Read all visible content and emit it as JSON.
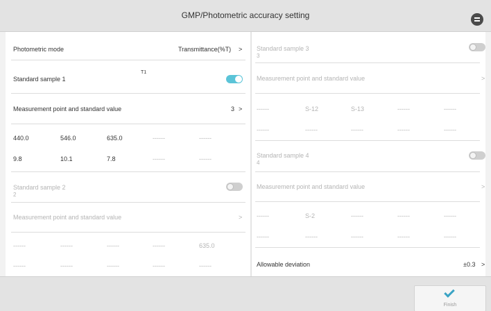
{
  "header": {
    "title": "GMP/Photometric accuracy setting",
    "back_icon": "exit-icon"
  },
  "left": {
    "mode_label": "Photometric mode",
    "mode_value": "Transmittance(%T)",
    "arrow": ">",
    "sample1": {
      "label": "Standard sample 1",
      "tag": "T1",
      "toggle": "on"
    },
    "mp1": {
      "label": "Measurement point and standard value",
      "count": "3"
    },
    "grid1_row1": [
      "440.0",
      "546.0",
      "635.0",
      "------",
      "------"
    ],
    "grid1_row2": [
      "9.8",
      "10.1",
      "7.8",
      "------",
      "------"
    ],
    "sample2": {
      "label": "Standard sample 2",
      "sub": "2",
      "toggle": "off"
    },
    "mp2": {
      "label": "Measurement point and standard value"
    },
    "grid2_row1": [
      "------",
      "------",
      "------",
      "------",
      "635.0"
    ],
    "grid2_row2": [
      "------",
      "------",
      "------",
      "------",
      "------"
    ]
  },
  "right": {
    "sample3": {
      "label": "Standard sample 3",
      "sub": "3",
      "toggle": "off"
    },
    "mp3": {
      "label": "Measurement point and standard value"
    },
    "grid3_row1": [
      "------",
      "S-12",
      "S-13",
      "------",
      "------"
    ],
    "grid3_row2": [
      "------",
      "------",
      "------",
      "------",
      "------"
    ],
    "sample4": {
      "label": "Standard sample 4",
      "sub": "4",
      "toggle": "off"
    },
    "mp4": {
      "label": "Measurement point and standard value"
    },
    "grid4_row1": [
      "------",
      "S-2",
      "------",
      "------",
      "------"
    ],
    "grid4_row2": [
      "------",
      "------",
      "------",
      "------",
      "------"
    ],
    "deviation": {
      "label": "Allowable deviation",
      "value": "±0.3"
    }
  },
  "footer": {
    "finish_label": "Finish",
    "finish_icon": "check-icon"
  },
  "colors": {
    "accent": "#5bc4d8",
    "check": "#3aa3c4"
  }
}
